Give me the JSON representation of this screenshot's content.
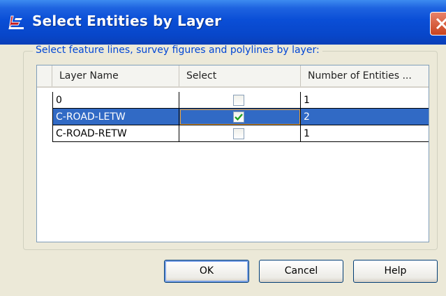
{
  "window": {
    "title": "Select Entities by Layer"
  },
  "group": {
    "legend": "Select feature lines, survey figures and polylines by layer:"
  },
  "table": {
    "columns": [
      "Layer Name",
      "Select",
      "Number of Entities ..."
    ],
    "rows": [
      {
        "layer": "0",
        "select": false,
        "count": "1",
        "selected": false
      },
      {
        "layer": "C-ROAD-LETW",
        "select": true,
        "count": "2",
        "selected": true
      },
      {
        "layer": "C-ROAD-RETW",
        "select": false,
        "count": "1",
        "selected": false
      }
    ]
  },
  "buttons": {
    "ok": "OK",
    "cancel": "Cancel",
    "help": "Help"
  },
  "colors": {
    "titlebar": "#0a4ed6",
    "selection": "#316ac5",
    "legend_text": "#0046d5"
  }
}
